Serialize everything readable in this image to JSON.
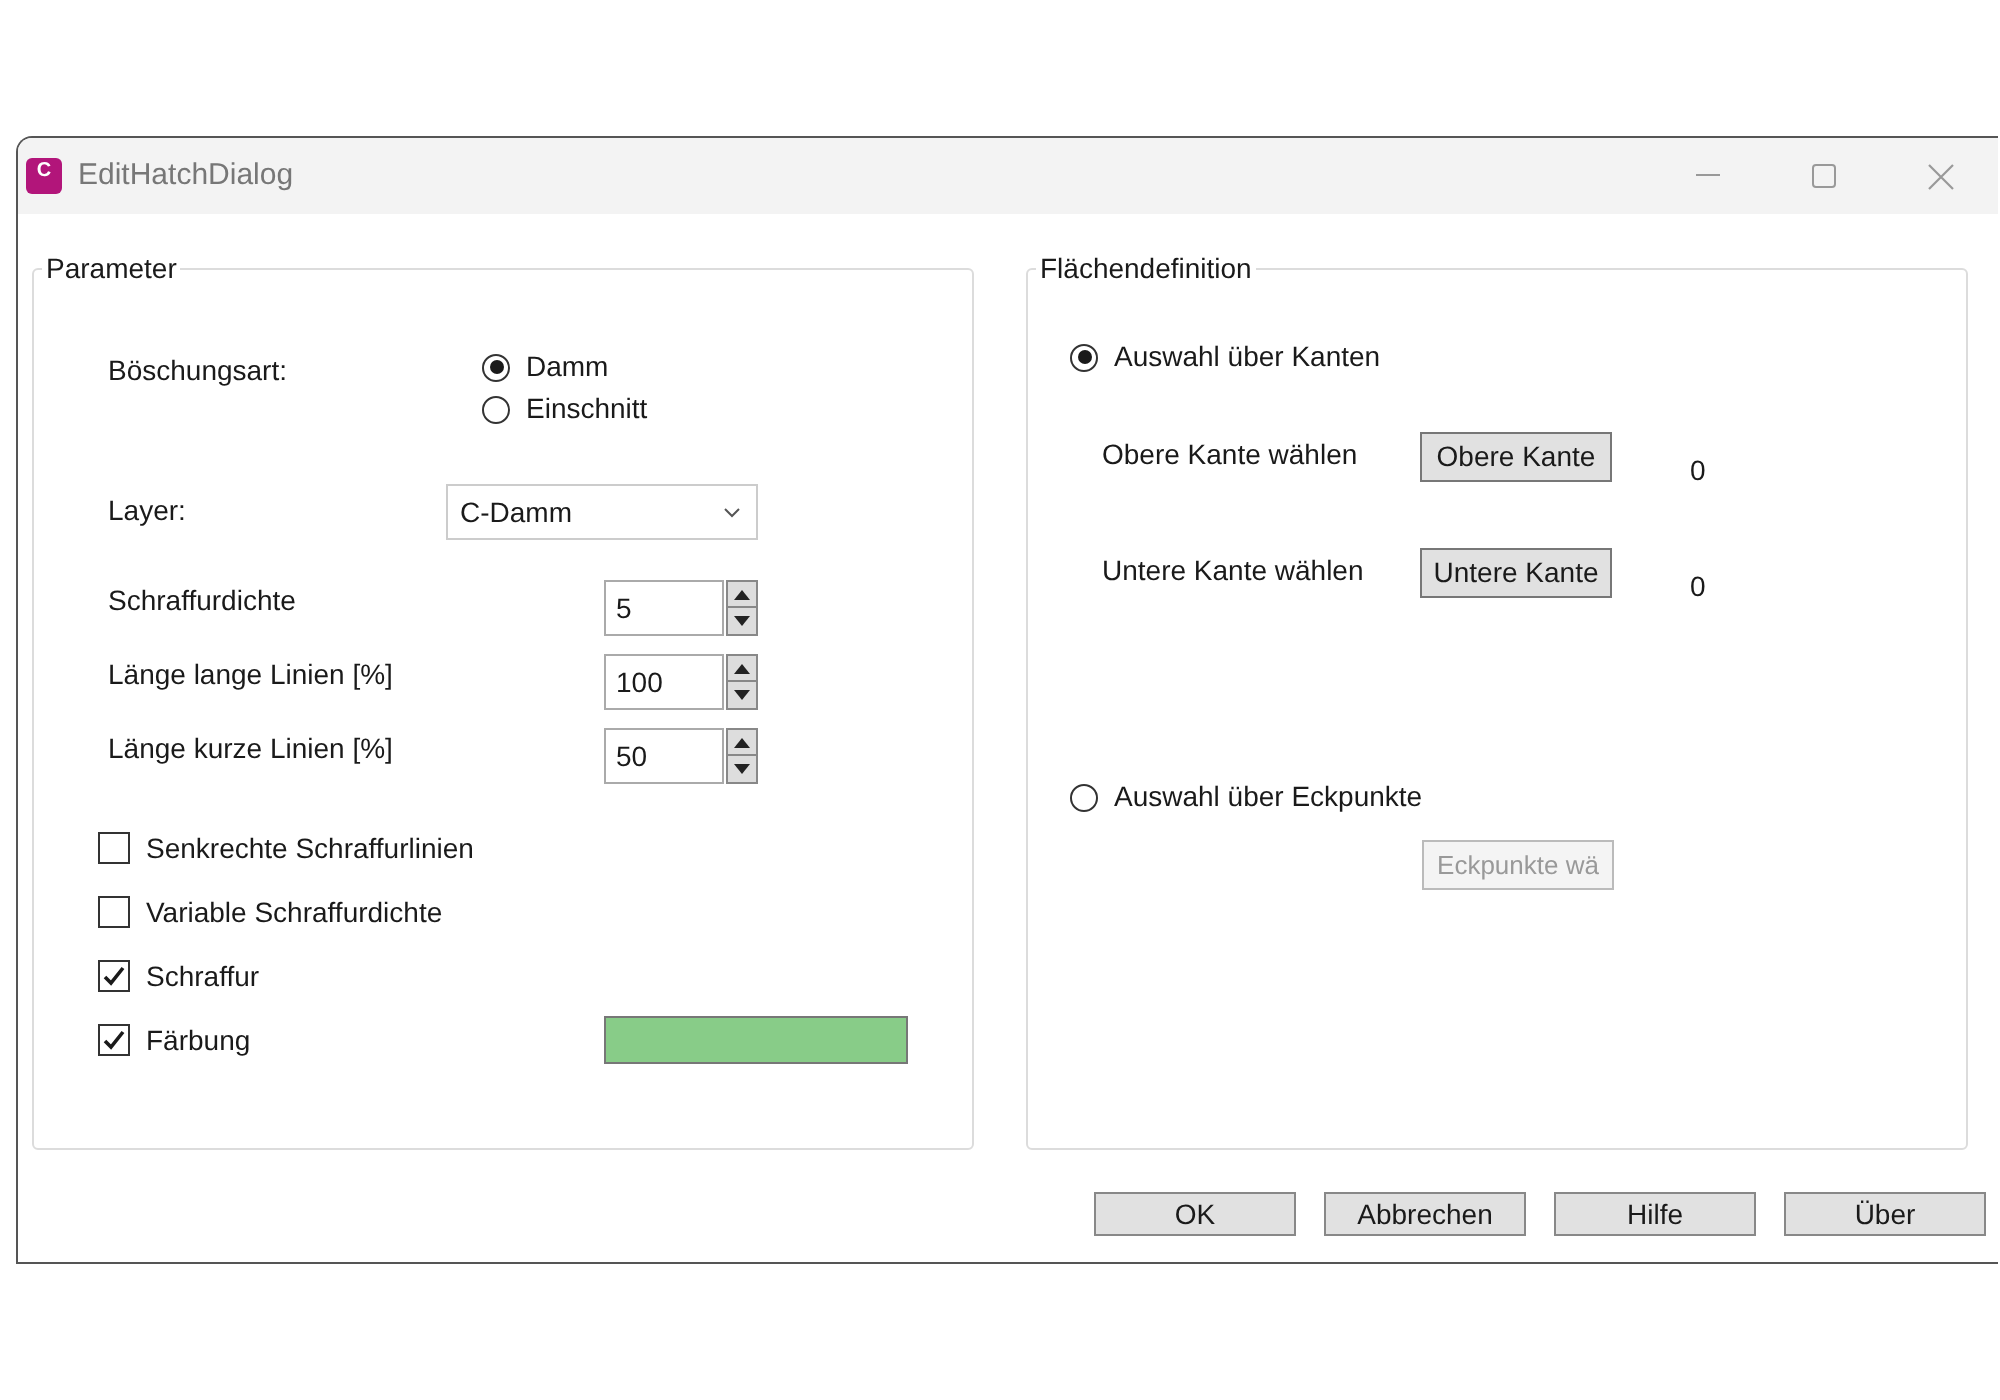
{
  "window": {
    "icon_text": "C",
    "title": "EditHatchDialog"
  },
  "parameter": {
    "title": "Parameter",
    "slope_type": {
      "label": "Böschungsart:",
      "options": [
        {
          "label": "Damm",
          "selected": true
        },
        {
          "label": "Einschnitt",
          "selected": false
        }
      ]
    },
    "layer": {
      "label": "Layer:",
      "value": "C-Damm"
    },
    "spinners": [
      {
        "label": "Schraffurdichte",
        "value": "5"
      },
      {
        "label": "Länge lange Linien [%]",
        "value": "100"
      },
      {
        "label": "Länge kurze Linien [%]",
        "value": "50"
      }
    ],
    "checkboxes": [
      {
        "label": "Senkrechte Schraffurlinien",
        "checked": false
      },
      {
        "label": "Variable Schraffurdichte",
        "checked": false
      },
      {
        "label": "Schraffur",
        "checked": true
      },
      {
        "label": "Färbung",
        "checked": true
      }
    ],
    "color_swatch": {
      "color": "#88cc88"
    }
  },
  "area": {
    "title": "Flächendefinition",
    "edge_option": {
      "label": "Auswahl über Kanten",
      "selected": true
    },
    "edge_rows": [
      {
        "label": "Obere Kante wählen",
        "button": "Obere Kante",
        "count": "0"
      },
      {
        "label": "Untere Kante wählen",
        "button": "Untere Kante",
        "count": "0"
      }
    ],
    "corner_option": {
      "label": "Auswahl über Eckpunkte",
      "selected": false
    },
    "corner_button": {
      "label": "Eckpunkte wä",
      "disabled": true
    }
  },
  "buttons": [
    "OK",
    "Abbrechen",
    "Hilfe",
    "Über"
  ]
}
